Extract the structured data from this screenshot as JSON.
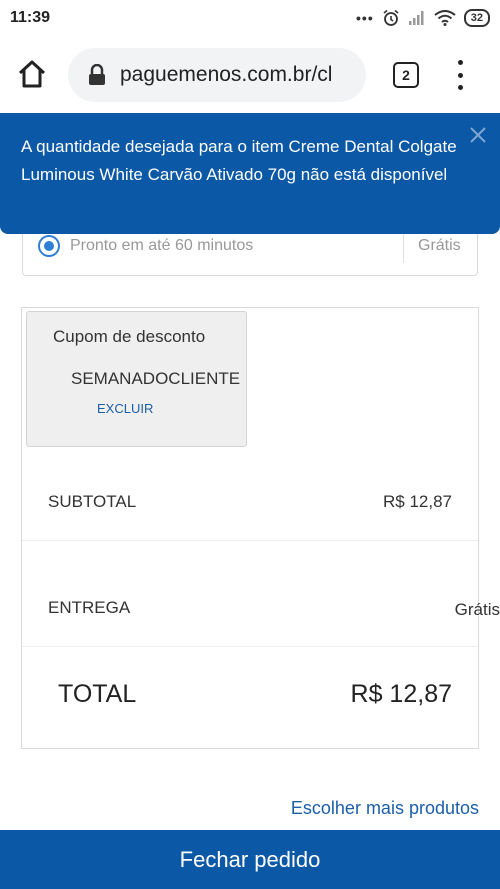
{
  "status_bar": {
    "time": "11:39",
    "battery": "32"
  },
  "browser": {
    "url": "paguemenos.com.br/cl",
    "tab_count": "2"
  },
  "alert": {
    "message": "A quantidade desejada para o item Creme Dental Colgate Luminous White Carvão Ativado 70g não está disponível",
    "color": "#0b58a6"
  },
  "delivery_option": {
    "label": "Pronto em até 60 minutos",
    "price": "Grátis"
  },
  "coupon": {
    "title": "Cupom de desconto",
    "code": "SEMANADOCLIENTE",
    "remove_label": "EXCLUIR"
  },
  "summary": {
    "subtotal_label": "SUBTOTAL",
    "subtotal_value": "R$ 12,87",
    "delivery_label": "ENTREGA",
    "delivery_value": "Grátis",
    "total_label": "TOTAL",
    "total_value": "R$ 12,87"
  },
  "links": {
    "more_products": "Escolher mais produtos"
  },
  "checkout": {
    "label": "Fechar pedido"
  }
}
